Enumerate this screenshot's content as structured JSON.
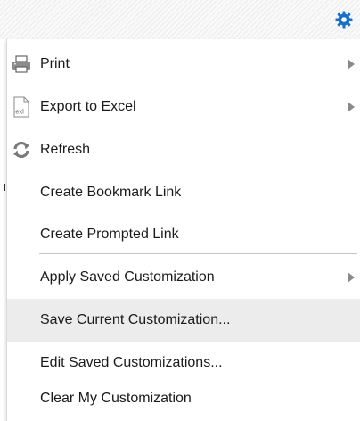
{
  "colors": {
    "accent": "#1a70c7",
    "highlight_row": "#ececec",
    "text": "#1b1b1b",
    "arrow": "#8a8a8a"
  },
  "toolbar": {
    "settings_icon": "gear-icon"
  },
  "menu": {
    "items": [
      {
        "label": "Print",
        "icon": "printer-icon",
        "has_submenu": true
      },
      {
        "label": "Export to Excel",
        "icon": "excel-file-icon",
        "icon_text": "exl",
        "has_submenu": true
      },
      {
        "label": "Refresh",
        "icon": "refresh-icon",
        "has_submenu": false
      },
      {
        "label": "Create Bookmark Link",
        "has_submenu": false
      },
      {
        "label": "Create Prompted Link",
        "has_submenu": false
      },
      {
        "label": "Apply Saved Customization",
        "has_submenu": true
      },
      {
        "label": "Save Current Customization...",
        "has_submenu": false,
        "highlighted": true
      },
      {
        "label": "Edit Saved Customizations...",
        "has_submenu": false
      },
      {
        "label": "Clear My Customization",
        "has_submenu": false
      }
    ]
  }
}
